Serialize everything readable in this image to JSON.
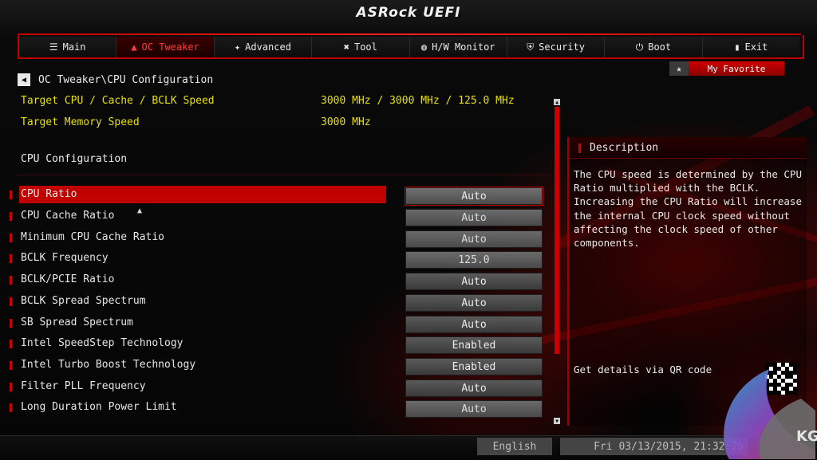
{
  "header": {
    "brand": "ASRock UEFI"
  },
  "tabs": [
    {
      "label": "Main",
      "icon": "list-icon"
    },
    {
      "label": "OC Tweaker",
      "icon": "rocket-icon",
      "active": true
    },
    {
      "label": "Advanced",
      "icon": "star-icon"
    },
    {
      "label": "Tool",
      "icon": "tools-icon"
    },
    {
      "label": "H/W Monitor",
      "icon": "monitor-icon"
    },
    {
      "label": "Security",
      "icon": "shield-icon"
    },
    {
      "label": "Boot",
      "icon": "power-icon"
    },
    {
      "label": "Exit",
      "icon": "exit-icon"
    }
  ],
  "favorite": {
    "label": "My Favorite"
  },
  "breadcrumb": {
    "path": "OC Tweaker\\CPU Configuration"
  },
  "info": [
    {
      "label": "Target CPU / Cache / BCLK Speed",
      "value": "3000 MHz / 3000 MHz / 125.0 MHz"
    },
    {
      "label": "Target Memory Speed",
      "value": "3000 MHz"
    }
  ],
  "section_title": "CPU Configuration",
  "settings": [
    {
      "label": "CPU Ratio",
      "value": "Auto"
    },
    {
      "label": "CPU Cache Ratio",
      "value": "Auto"
    },
    {
      "label": "Minimum CPU Cache Ratio",
      "value": "Auto"
    },
    {
      "label": "BCLK Frequency",
      "value": "125.0"
    },
    {
      "label": "BCLK/PCIE Ratio",
      "value": "Auto"
    },
    {
      "label": "BCLK Spread Spectrum",
      "value": "Auto"
    },
    {
      "label": "SB Spread Spectrum",
      "value": "Auto"
    },
    {
      "label": "Intel SpeedStep Technology",
      "value": "Enabled"
    },
    {
      "label": "Intel Turbo Boost Technology",
      "value": "Enabled"
    },
    {
      "label": "Filter PLL Frequency",
      "value": "Auto"
    },
    {
      "label": "Long Duration Power Limit",
      "value": "Auto"
    }
  ],
  "description": {
    "title": "Description",
    "body": "The CPU speed is determined by the CPU\nRatio multiplied with the BCLK.\nIncreasing the CPU Ratio will increase\nthe internal CPU clock speed without\naffecting the clock speed of other\ncomponents.",
    "qr_text": "Get details via QR code"
  },
  "footer": {
    "language": "English",
    "datetime": "Fri 03/13/2015, 21:32:26"
  },
  "watermark": {
    "text": "KG"
  },
  "colors": {
    "accent": "#c00000",
    "info_text": "#e8e000"
  }
}
